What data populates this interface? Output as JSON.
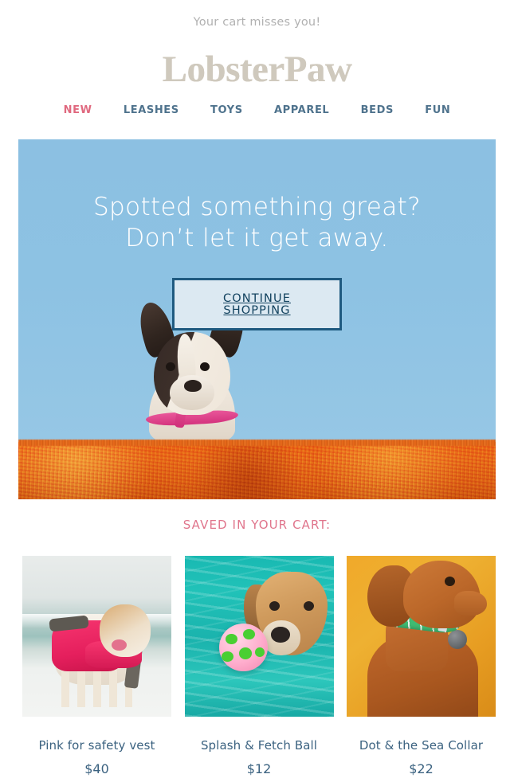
{
  "preheader": {
    "text": "Your cart misses you!"
  },
  "brand": {
    "name": "LobsterPaw",
    "color_top": "#cfc9bd",
    "color_bottom": "#2eb8cf"
  },
  "nav": {
    "items": [
      {
        "label": "NEW",
        "accent": true
      },
      {
        "label": "LEASHES",
        "accent": false
      },
      {
        "label": "TOYS",
        "accent": false
      },
      {
        "label": "APPAREL",
        "accent": false
      },
      {
        "label": "BEDS",
        "accent": false
      },
      {
        "label": "FUN",
        "accent": false
      }
    ],
    "accent_color": "#e0697f",
    "link_color": "#4f738d"
  },
  "hero": {
    "heading_line1": "Spotted something great?",
    "heading_line2": "Don’t let it get away.",
    "cta_label": "CONTINUE  SHOPPING",
    "sky_color": "#8cc0e2",
    "wall_color": "#e4711f",
    "cta_border_color": "#1f5a80",
    "cta_fill_color": "#dce9f2",
    "cta_text_color": "#12425f",
    "image_alt": "french-bulldog-behind-orange-wall"
  },
  "cart": {
    "title": "SAVED IN YOUR CART:",
    "title_color": "#e0758c",
    "products": [
      {
        "name": "Pink for safety vest",
        "price": "$40",
        "image_alt": "bulldog-in-pink-life-vest-on-beach"
      },
      {
        "name": "Splash & Fetch Ball",
        "price": "$12",
        "image_alt": "golden-retriever-swimming-with-ball"
      },
      {
        "name": "Dot & the Sea Collar",
        "price": "$22",
        "image_alt": "vizsla-wearing-green-polka-dot-collar"
      }
    ],
    "text_color": "#3b6280"
  }
}
